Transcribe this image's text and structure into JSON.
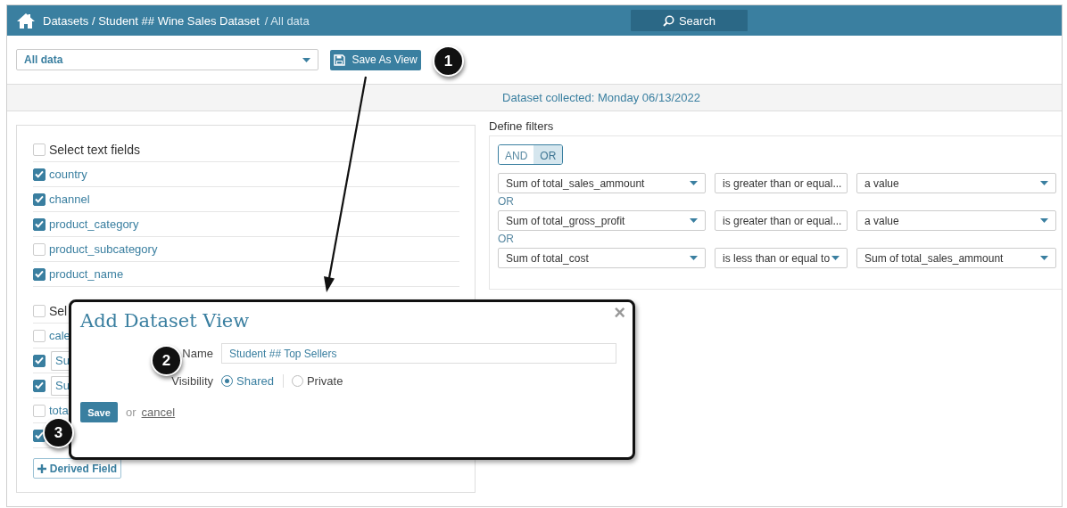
{
  "topbar": {
    "path": "Datasets / Student ## Wine Sales Dataset",
    "current": "/ All data",
    "search": "Search"
  },
  "toolbar": {
    "view": "All data",
    "save_view": "Save As View"
  },
  "collected": "Dataset collected: Monday 06/13/2022",
  "field_groups": [
    {
      "label": "Select text fields",
      "checked": false,
      "items": [
        {
          "label": "country",
          "checked": true,
          "kind": "plain"
        },
        {
          "label": "channel",
          "checked": true,
          "kind": "plain"
        },
        {
          "label": "product_category",
          "checked": true,
          "kind": "plain"
        },
        {
          "label": "product_subcategory",
          "checked": false,
          "kind": "plain"
        },
        {
          "label": "product_name",
          "checked": true,
          "kind": "plain"
        }
      ]
    },
    {
      "label": "Sel",
      "checked": false,
      "items": [
        {
          "label": "cale",
          "checked": false,
          "kind": "plain"
        },
        {
          "label": "Su",
          "checked": true,
          "kind": "select"
        },
        {
          "label": "Su",
          "checked": true,
          "kind": "select"
        },
        {
          "label": "tota",
          "checked": false,
          "kind": "plain"
        },
        {
          "checked": true,
          "kind": "plain"
        }
      ]
    }
  ],
  "derived_field": "Derived Field",
  "filters": {
    "title": "Define filters",
    "logic": [
      {
        "label": "AND",
        "selected": false
      },
      {
        "label": "OR",
        "selected": true
      }
    ],
    "rows": [
      {
        "field": "Sum of total_sales_ammount",
        "operator": "is greater than or equal...",
        "value": "a value"
      },
      {
        "joiner": "OR",
        "field": "Sum of total_gross_profit",
        "operator": "is greater than or equal...",
        "value": "a value"
      },
      {
        "joiner": "OR",
        "field": "Sum of total_cost",
        "operator": "is less than or equal to",
        "value": "Sum of total_sales_ammount"
      }
    ]
  },
  "dialog": {
    "title": "Add Dataset View",
    "close": "×",
    "name_label": "Name",
    "name_value": "Student ## Top Sellers",
    "visibility_label": "Visibility",
    "options": [
      {
        "label": "Shared",
        "selected": true
      },
      {
        "label": "Private",
        "selected": false
      }
    ],
    "save": "Save",
    "or": "or",
    "cancel": "cancel"
  },
  "callouts": [
    "1",
    "2",
    "3"
  ]
}
